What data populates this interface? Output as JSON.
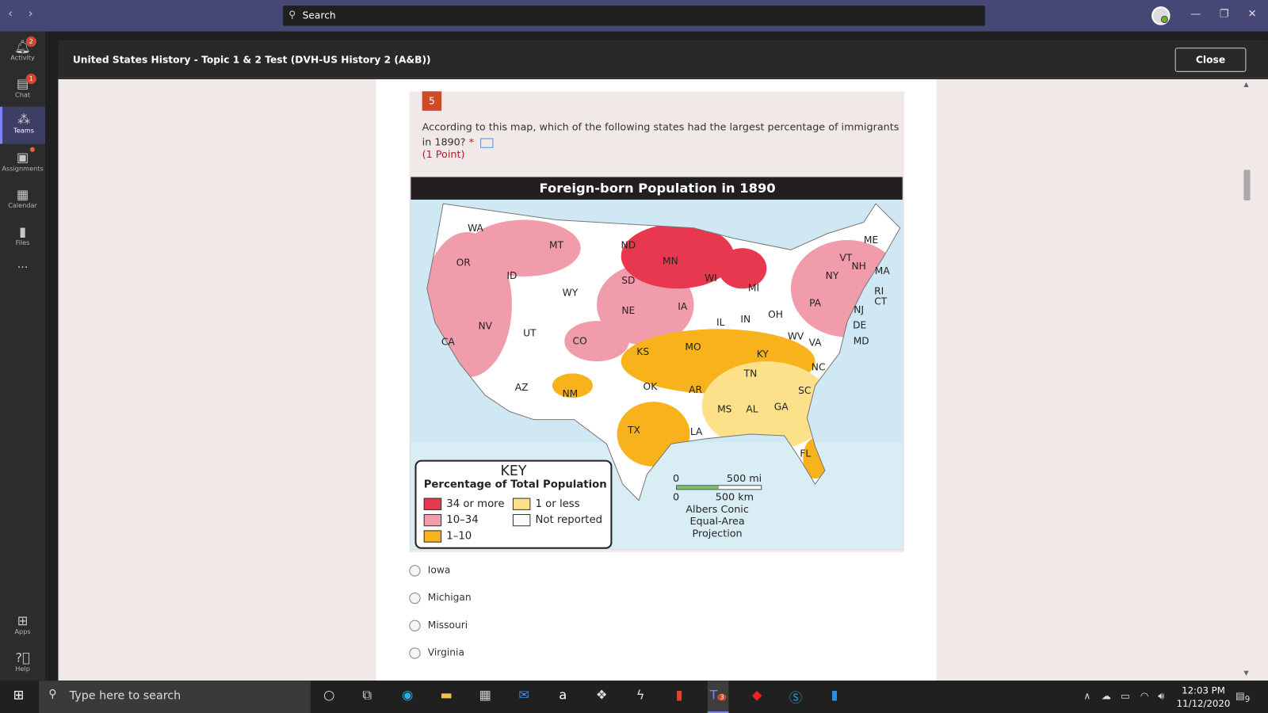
{
  "titlebar": {
    "search_placeholder": "Search",
    "back": "‹",
    "forward": "›"
  },
  "rail": [
    {
      "label": "Activity",
      "badge": "2"
    },
    {
      "label": "Chat",
      "badge": "1"
    },
    {
      "label": "Teams"
    },
    {
      "label": "Assignments"
    },
    {
      "label": "Calendar"
    },
    {
      "label": "Files"
    },
    {
      "label": "..."
    },
    {
      "label": "Apps"
    },
    {
      "label": "Help"
    }
  ],
  "header": {
    "title": "United States History - Topic 1 & 2 Test (DVH-US History 2 (A&B))",
    "close": "Close"
  },
  "question": {
    "number": "5",
    "text": "According to this map, which of the following states had the largest percentage of immigrants in 1890?",
    "required": "*",
    "points": "(1 Point)",
    "options": [
      "Iowa",
      "Michigan",
      "Missouri",
      "Virginia"
    ]
  },
  "map": {
    "title": "Foreign-born Population in 1890",
    "states": [
      "WA",
      "MT",
      "ND",
      "MN",
      "OR",
      "ID",
      "SD",
      "WI",
      "MI",
      "WY",
      "NE",
      "IA",
      "IL",
      "IN",
      "OH",
      "PA",
      "NY",
      "VT",
      "NH",
      "ME",
      "MA",
      "RI",
      "CT",
      "NJ",
      "DE",
      "MD",
      "NV",
      "UT",
      "CO",
      "KS",
      "MO",
      "KY",
      "WV",
      "VA",
      "CA",
      "TN",
      "NC",
      "OK",
      "AR",
      "SC",
      "AZ",
      "NM",
      "MS",
      "AL",
      "GA",
      "TX",
      "LA",
      "FL"
    ],
    "key": {
      "title": "KEY",
      "subtitle": "Percentage of Total Population",
      "items": [
        {
          "label": "34 or more",
          "color": "#e8384f"
        },
        {
          "label": "10–34",
          "color": "#f19cab"
        },
        {
          "label": "1–10",
          "color": "#f7b21c"
        },
        {
          "label": "1 or less",
          "color": "#fde08a"
        },
        {
          "label": "Not reported",
          "color": "#ffffff"
        }
      ]
    },
    "scale": {
      "zero_mi": "0",
      "mi": "500 mi",
      "zero_km": "0",
      "km": "500 km",
      "projection": "Albers Conic Equal-Area Projection"
    }
  },
  "taskbar": {
    "search": "Type here to search",
    "time": "12:03 PM",
    "date": "11/12/2020",
    "teams_badge": "3",
    "notif": "9"
  }
}
